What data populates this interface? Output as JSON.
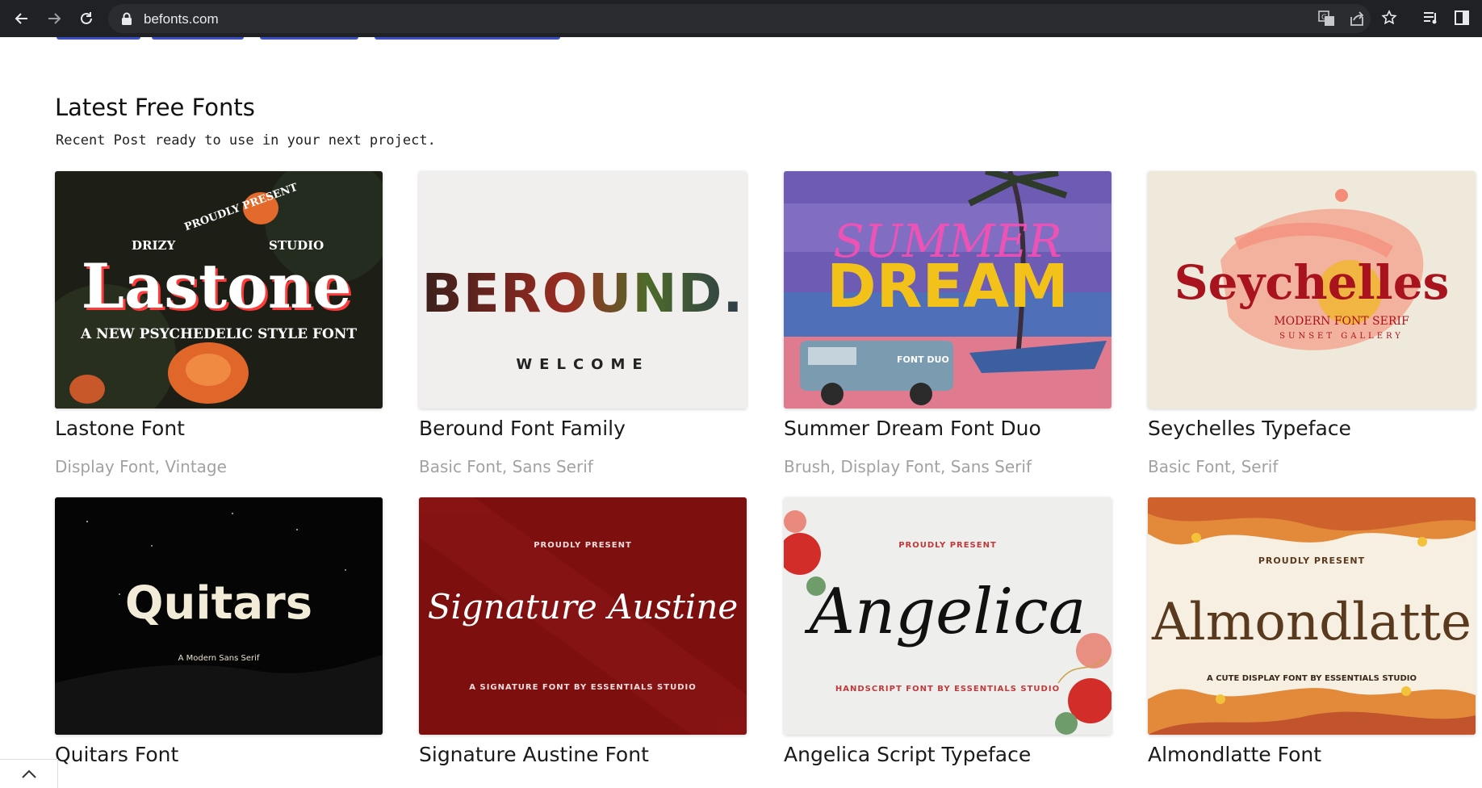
{
  "browser": {
    "url": "befonts.com",
    "icons": {
      "back": "arrow-left-icon",
      "forward": "arrow-right-icon",
      "reload": "reload-icon",
      "lock": "lock-icon",
      "translate": "translate-icon",
      "share": "share-icon",
      "bookmark": "star-icon",
      "reading_list": "reading-list-icon",
      "side_panel": "side-panel-icon"
    }
  },
  "section": {
    "title": "Latest Free Fonts",
    "subtitle": "Recent Post ready to use in your next project."
  },
  "cards": [
    {
      "title": "Lastone Font",
      "tags": "Display Font, Vintage",
      "art": {
        "badge_words": [
          "DRIZY",
          "PROUDLY PRESENT",
          "STUDIO"
        ],
        "main": "Lastone",
        "sub": "A NEW PSYCHEDELIC STYLE FONT"
      }
    },
    {
      "title": "Beround Font Family",
      "tags": "Basic Font, Sans Serif",
      "art": {
        "main": "BEROUND.",
        "sub": "WELCOME"
      }
    },
    {
      "title": "Summer Dream Font Duo",
      "tags": "Brush, Display Font, Sans Serif",
      "art": {
        "script": "SUMMER",
        "main": "DREAM",
        "sub": "FONT DUO"
      }
    },
    {
      "title": "Seychelles Typeface",
      "tags": "Basic Font, Serif",
      "art": {
        "main": "Seychelles",
        "sub": "MODERN FONT SERIF",
        "sub2": "SUNSET GALLERY"
      }
    },
    {
      "title": "Quitars Font",
      "tags": "",
      "art": {
        "main": "Quitars",
        "sub": "A Modern Sans Serif"
      }
    },
    {
      "title": "Signature Austine Font",
      "tags": "",
      "art": {
        "top": "PROUDLY PRESENT",
        "main": "Signature Austine",
        "sub": "A SIGNATURE FONT BY ESSENTIALS STUDIO"
      }
    },
    {
      "title": "Angelica Script Typeface",
      "tags": "",
      "art": {
        "top": "PROUDLY PRESENT",
        "main": "Angelica",
        "sub": "HANDSCRIPT FONT BY ESSENTIALS STUDIO"
      }
    },
    {
      "title": "Almondlatte Font",
      "tags": "",
      "art": {
        "top": "PROUDLY PRESENT",
        "main": "Almondlatte",
        "sub": "A CUTE DISPLAY FONT BY ESSENTIALS STUDIO"
      }
    }
  ],
  "scroll_top_icon": "chevron-up-icon"
}
